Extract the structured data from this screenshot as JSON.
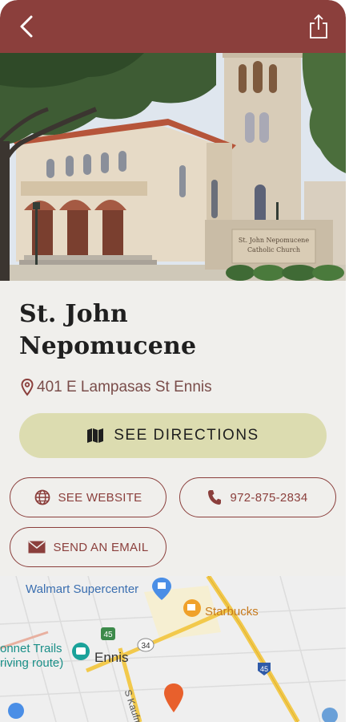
{
  "header": {
    "back_icon": "chevron-left-icon",
    "share_icon": "share-icon",
    "bar_color": "#8b3f3c"
  },
  "hero": {
    "sign_line1": "St. John Nepomucene",
    "sign_line2": "Catholic Church"
  },
  "place": {
    "title_line1": "St. John",
    "title_line2": "Nepomucene",
    "address": "401 E Lampasas St Ennis"
  },
  "actions": {
    "directions_label": "SEE DIRECTIONS",
    "website_label": "SEE WEBSITE",
    "phone_label": "972-875-2834",
    "email_label": "SEND AN EMAIL"
  },
  "map": {
    "walmart": "Walmart Supercenter",
    "starbucks": "Starbucks",
    "trails_line1": "onnet Trails",
    "trails_line2": "riving route)",
    "city": "Ennis",
    "route_45": "45",
    "route_34": "34",
    "street": "S Kaufm"
  },
  "colors": {
    "accent": "#8b3f3c",
    "directions_bg": "#dcdcb0",
    "page_bg": "#f0efec"
  }
}
